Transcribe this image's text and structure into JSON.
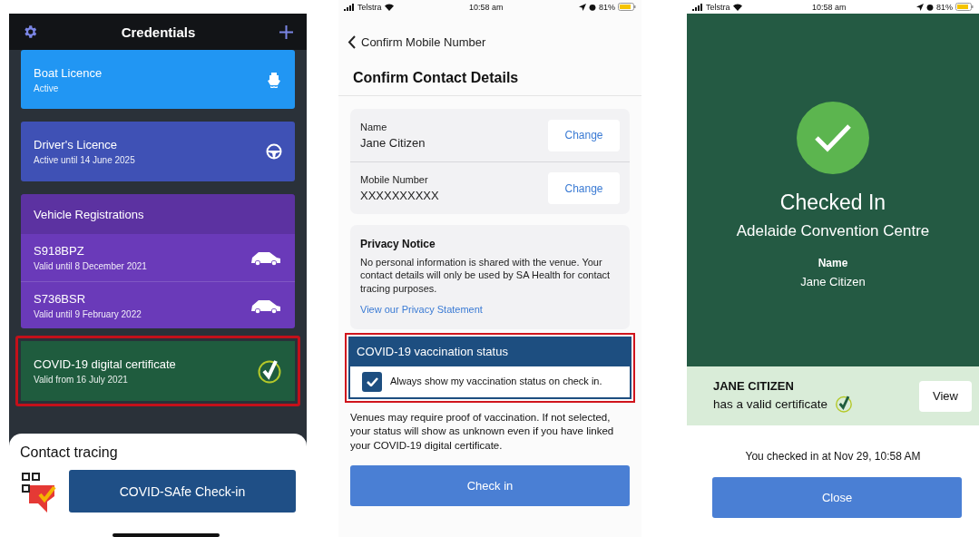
{
  "credentials_screen": {
    "title": "Credentials",
    "cards": [
      {
        "kind": "credential",
        "title": "Boat Licence",
        "subtitle": "Active",
        "color": "#2196f3",
        "highlighted": false
      },
      {
        "kind": "credential",
        "title": "Driver's Licence",
        "subtitle": "Active until 14 June 2025",
        "color": "#3f51b5",
        "highlighted": false
      },
      {
        "kind": "group",
        "title": "Vehicle Registrations",
        "color": "#6a3ab9",
        "highlighted": false,
        "items": [
          {
            "title": "S918BPZ",
            "subtitle": "Valid until 8 December 2021"
          },
          {
            "title": "S736BSR",
            "subtitle": "Valid until 9 February 2022"
          }
        ]
      },
      {
        "kind": "credential",
        "title": "COVID-19 digital certificate",
        "subtitle": "Valid from 16 July 2021",
        "color": "#1f5c3e",
        "highlighted": true
      }
    ],
    "contact_tracing": {
      "title": "Contact tracing",
      "button": "COVID-SAfe Check-in"
    }
  },
  "confirm_screen": {
    "status_bar": {
      "carrier": "Telstra",
      "time": "10:58 am",
      "battery": "81%"
    },
    "back": "Confirm Mobile Number",
    "heading": "Confirm Contact Details",
    "fields": [
      {
        "label": "Name",
        "value": "Jane Citizen",
        "action": "Change"
      },
      {
        "label": "Mobile Number",
        "value": "XXXXXXXXXX",
        "action": "Change"
      }
    ],
    "privacy": {
      "title": "Privacy Notice",
      "text": "No personal information is shared with the venue. Your contact details will only be used by SA Health for contact tracing purposes.",
      "link": "View our Privacy Statement"
    },
    "vaccination": {
      "title": "COVID-19 vaccination status",
      "label": "Always show my vaccination status on check in.",
      "checked": true,
      "highlighted": true
    },
    "note": "Venues may require proof of vaccination. If not selected, your status will show as unknown even if you have linked your COVID-19 digital certificate.",
    "button": "Check in"
  },
  "checked_in_screen": {
    "status_bar": {
      "carrier": "Telstra",
      "time": "10:58 am",
      "battery": "81%"
    },
    "title": "Checked In",
    "venue": "Adelaide Convention Centre",
    "name_label": "Name",
    "name": "Jane Citizen",
    "certificate": {
      "holder": "JANE CITIZEN",
      "status": "has a valid certificate",
      "button": "View"
    },
    "timestamp": "You checked in at Nov 29, 10:58 AM",
    "button": "Close"
  }
}
